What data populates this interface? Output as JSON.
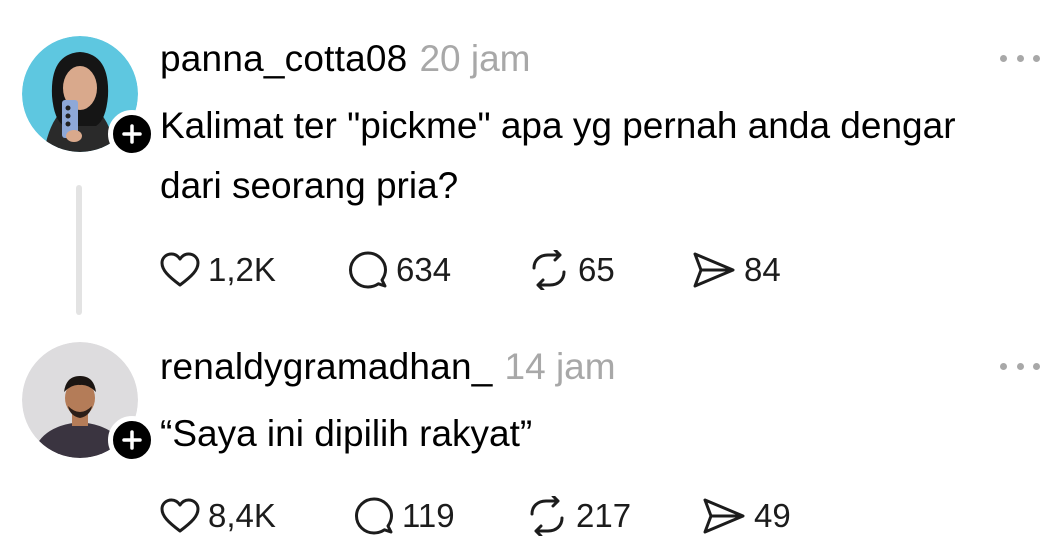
{
  "posts": [
    {
      "username": "panna_cotta08",
      "time": "20 jam",
      "text_lines": [
        "Kalimat ter \"pickme\" apa yg pernah anda dengar",
        "dari seorang pria?"
      ],
      "avatar_icon": "avatar-photo-woman",
      "stats": {
        "likes": "1,2K",
        "replies": "634",
        "reposts": "65",
        "shares": "84"
      }
    },
    {
      "username": "renaldygramadhan_",
      "time": "14 jam",
      "text_lines": [
        "“Saya ini dipilih rakyat”"
      ],
      "avatar_icon": "avatar-photo-man",
      "stats": {
        "likes": "8,4K",
        "replies": "119",
        "reposts": "217",
        "shares": "49"
      }
    }
  ],
  "icons": {
    "like": "heart-icon",
    "reply": "comment-icon",
    "repost": "repost-icon",
    "share": "send-icon",
    "more": "more-options-icon",
    "follow": "plus-icon"
  },
  "colors": {
    "text": "#000000",
    "muted": "#a8a8a8",
    "thread_line": "#e3e3e3",
    "badge": "#000000"
  }
}
